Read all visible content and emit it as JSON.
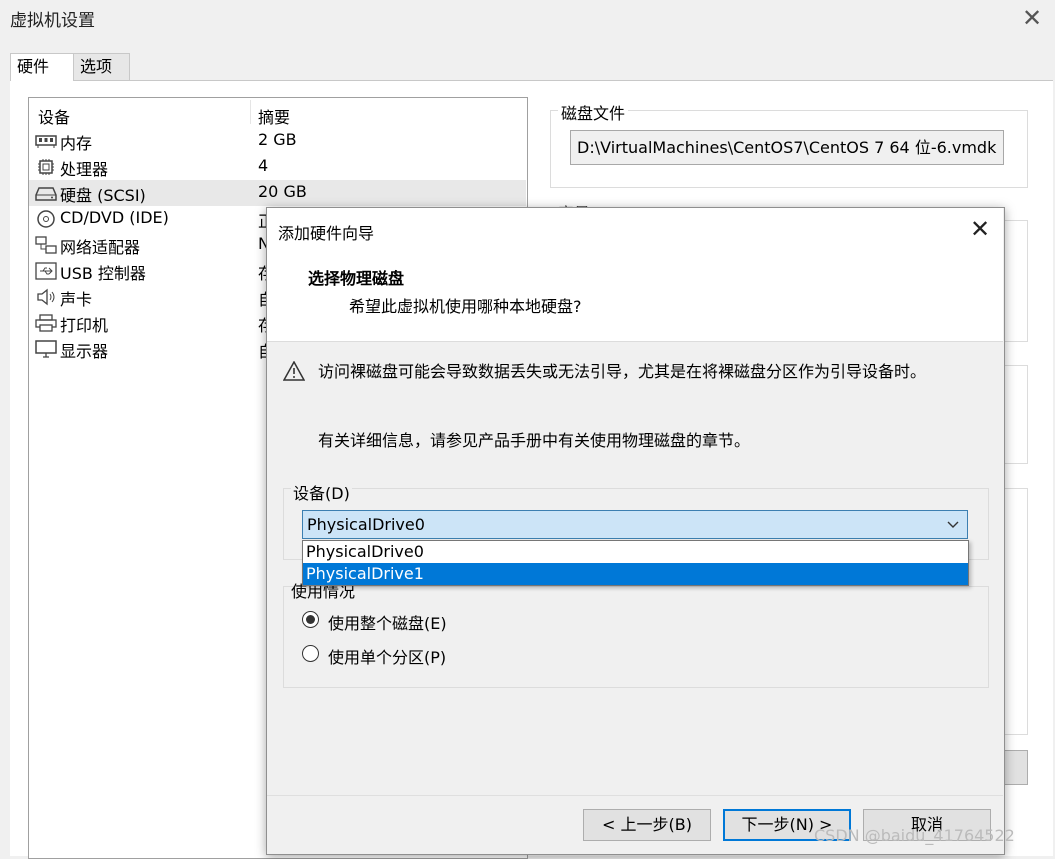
{
  "window": {
    "title": "虚拟机设置"
  },
  "tabs": [
    {
      "label": "硬件"
    },
    {
      "label": "选项"
    }
  ],
  "device_list": {
    "headers": {
      "device": "设备",
      "summary": "摘要"
    },
    "rows": [
      {
        "name": "内存",
        "summary": "2 GB",
        "icon": "memory-icon"
      },
      {
        "name": "处理器",
        "summary": "4",
        "icon": "cpu-icon"
      },
      {
        "name": "硬盘 (SCSI)",
        "summary": "20 GB",
        "icon": "hard-disk-icon"
      },
      {
        "name": "CD/DVD (IDE)",
        "summary": "正",
        "icon": "cd-icon"
      },
      {
        "name": "网络适配器",
        "summary": "N",
        "icon": "network-icon"
      },
      {
        "name": "USB 控制器",
        "summary": "存",
        "icon": "usb-icon"
      },
      {
        "name": "声卡",
        "summary": "自",
        "icon": "speaker-icon"
      },
      {
        "name": "打印机",
        "summary": "存",
        "icon": "printer-icon"
      },
      {
        "name": "显示器",
        "summary": "自",
        "icon": "monitor-icon"
      }
    ]
  },
  "disk_file": {
    "label": "磁盘文件",
    "value": "D:\\VirtualMachines\\CentOS7\\CentOS 7 64 位-6.vmdk"
  },
  "capacity_label": "容量",
  "dialog": {
    "title": "添加硬件向导",
    "heading": "选择物理磁盘",
    "subheading": "希望此虚拟机使用哪种本地硬盘?",
    "warning": "访问裸磁盘可能会导致数据丢失或无法引导，尤其是在将裸磁盘分区作为引导设备时。",
    "info": "有关详细信息，请参见产品手册中有关使用物理磁盘的章节。",
    "device_label": "设备(D)",
    "device_selected": "PhysicalDrive0",
    "device_options": [
      "PhysicalDrive0",
      "PhysicalDrive1"
    ],
    "usage_label": "使用情况",
    "radio_whole": "使用整个磁盘(E)",
    "radio_partition": "使用单个分区(P)",
    "btn_back": "< 上一步(B)",
    "btn_next": "下一步(N) >",
    "btn_cancel": "取消"
  },
  "watermark": "CSDN @baidu_41764522",
  "colors": {
    "highlight": "#0078d7",
    "select_bg": "#cce4f7"
  }
}
